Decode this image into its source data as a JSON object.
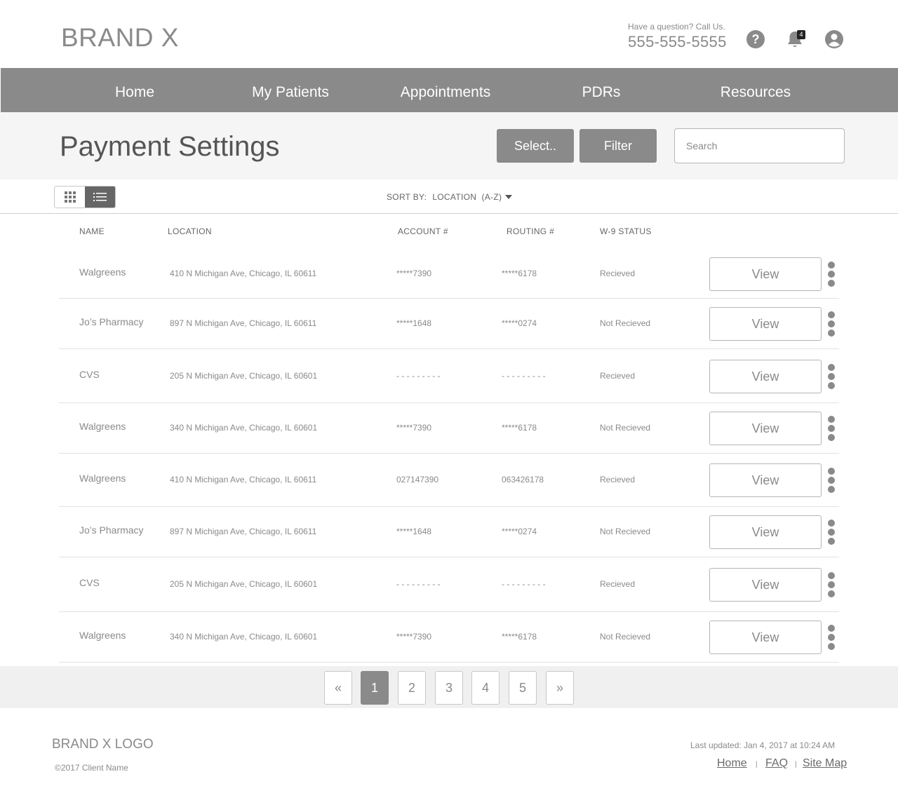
{
  "header": {
    "brand": "BRAND X",
    "question": "Have a question? Call Us.",
    "phone": "555-555-5555",
    "notification_count": "4",
    "icons": [
      "help-icon",
      "bell-icon",
      "user-icon"
    ]
  },
  "nav": {
    "items": [
      "Home",
      "My Patients",
      "Appointments",
      "PDRs",
      "Resources"
    ]
  },
  "page": {
    "title": "Payment Settings",
    "select_label": "Select..",
    "filter_label": "Filter",
    "search_placeholder": "Search"
  },
  "toolbar": {
    "sort_label": "SORT BY:",
    "sort_value": "LOCATION  (A-Z)"
  },
  "table": {
    "headers": [
      "NAME",
      "LOCATION",
      "ACCOUNT #",
      "ROUTING #",
      "W-9 STATUS"
    ],
    "view_label": "View",
    "rows": [
      {
        "name": "Walgreens",
        "location": "410 N Michigan Ave, Chicago, IL 60611",
        "account": "*****7390",
        "routing": "*****6178",
        "status": "Recieved"
      },
      {
        "name": "Jo’s Pharmacy",
        "location": "897 N Michigan Ave, Chicago, IL 60611",
        "account": "*****1648",
        "routing": "*****0274",
        "status": "Not Recieved"
      },
      {
        "name": "CVS",
        "location": "205 N Michigan Ave, Chicago, IL 60601",
        "account": "- - - - - - - - -",
        "routing": "- - - - - - - - -",
        "status": "Recieved"
      },
      {
        "name": "Walgreens",
        "location": "340 N Michigan Ave, Chicago, IL 60601",
        "account": "*****7390",
        "routing": "*****6178",
        "status": "Not Recieved"
      },
      {
        "name": "Walgreens",
        "location": "410 N Michigan Ave, Chicago, IL 60611",
        "account": "027147390",
        "routing": "063426178",
        "status": "Recieved"
      },
      {
        "name": "Jo’s Pharmacy",
        "location": "897 N Michigan Ave, Chicago, IL 60611",
        "account": "*****1648",
        "routing": "*****0274",
        "status": "Not Recieved"
      },
      {
        "name": "CVS",
        "location": "205 N Michigan Ave, Chicago, IL 60601",
        "account": "- - - - - - - - -",
        "routing": "- - - - - - - - -",
        "status": "Recieved"
      },
      {
        "name": "Walgreens",
        "location": "340 N Michigan Ave, Chicago, IL 60601",
        "account": "*****7390",
        "routing": "*****6178",
        "status": "Not Recieved"
      }
    ]
  },
  "pagination": {
    "prev": "«",
    "pages": [
      "1",
      "2",
      "3",
      "4",
      "5"
    ],
    "current": "1",
    "next": "»"
  },
  "footer": {
    "logo": "BRAND X LOGO",
    "copyright": "©2017 Client Name",
    "updated": "Last updated: Jan 4, 2017 at 10:24 AM",
    "links": [
      "Home",
      "FAQ",
      "Site Map"
    ],
    "separator": "|"
  },
  "colors": {
    "nav_bg": "#8a8a8a",
    "title_bar_bg": "#f5f5f5",
    "active_toggle": "#666666",
    "page_bar_bg": "#f0f0f0"
  }
}
